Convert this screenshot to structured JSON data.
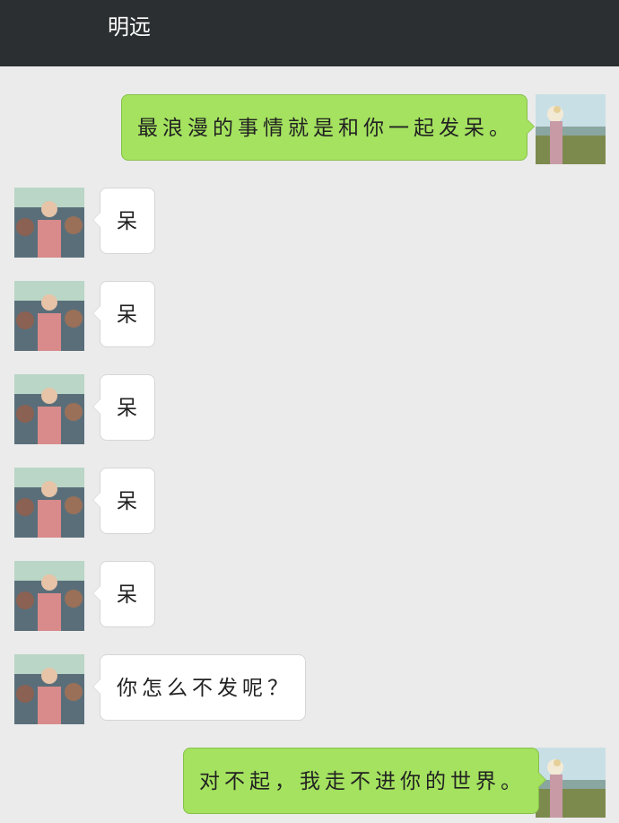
{
  "header": {
    "title": "明远"
  },
  "messages": [
    {
      "sender": "me",
      "avatar": "woman-avatar-icon",
      "text": "最浪漫的事情就是和你一起发呆。"
    },
    {
      "sender": "contact",
      "avatar": "man-avatar-icon",
      "text": "呆"
    },
    {
      "sender": "contact",
      "avatar": "man-avatar-icon",
      "text": "呆"
    },
    {
      "sender": "contact",
      "avatar": "man-avatar-icon",
      "text": "呆"
    },
    {
      "sender": "contact",
      "avatar": "man-avatar-icon",
      "text": "呆"
    },
    {
      "sender": "contact",
      "avatar": "man-avatar-icon",
      "text": "呆"
    },
    {
      "sender": "contact",
      "avatar": "man-avatar-icon",
      "text": "你怎么不发呢？"
    },
    {
      "sender": "me",
      "avatar": "woman-avatar-icon",
      "text": "对不起，我走不进你的世界。"
    }
  ],
  "colors": {
    "header_bg": "#2b2f31",
    "chat_bg": "#ebebeb",
    "outgoing_bubble": "#a4e25f",
    "incoming_bubble": "#ffffff"
  }
}
